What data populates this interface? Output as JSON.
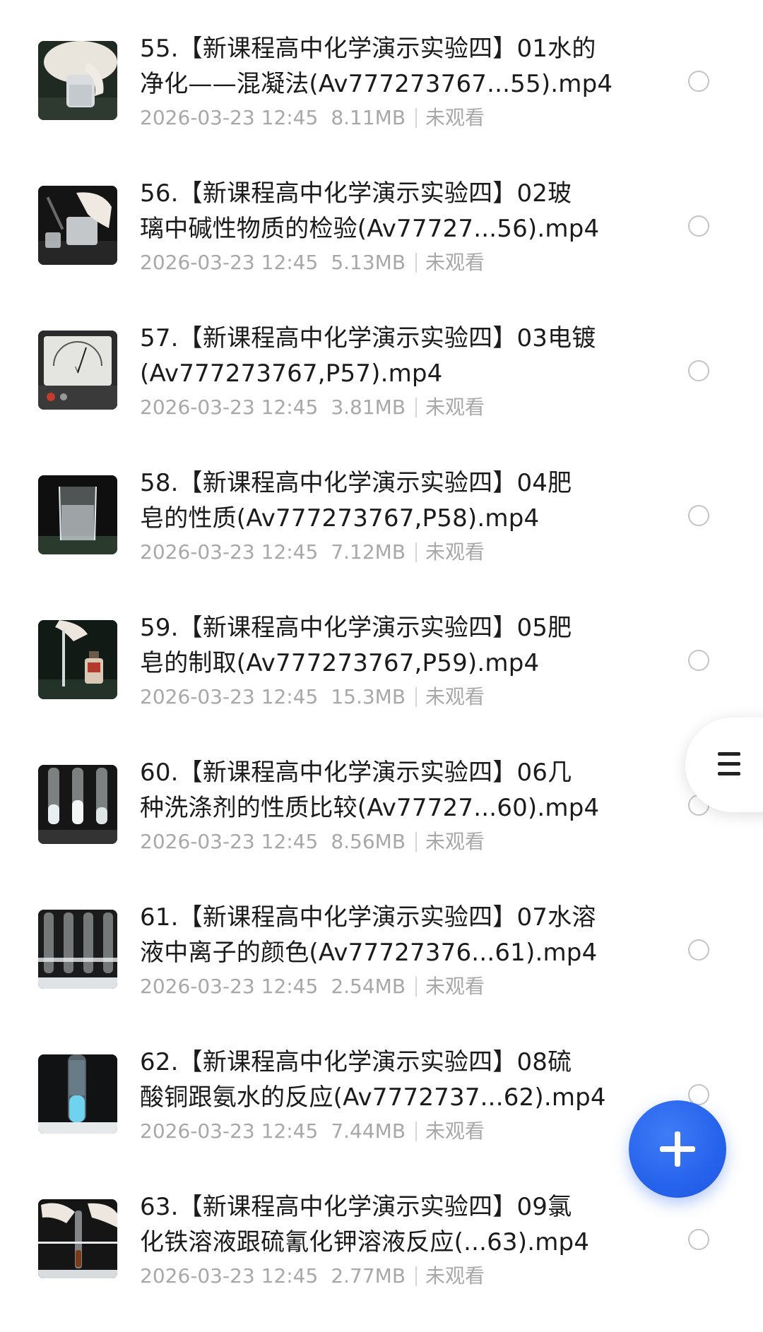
{
  "files": [
    {
      "title_line1": "55.【新课程高中化学演示实验四】01水的",
      "title_line2": "净化——混凝法(Av777273767...55).mp4",
      "date": "2026-03-23 12:45",
      "size": "8.11MB",
      "status": "未观看",
      "thumb_icon": "hand-holding-bottle-thumbnail"
    },
    {
      "title_line1": "56.【新课程高中化学演示实验四】02玻",
      "title_line2": "璃中碱性物质的检验(Av77727...56).mp4",
      "date": "2026-03-23 12:45",
      "size": "5.13MB",
      "status": "未观看",
      "thumb_icon": "hand-with-glass-thumbnail"
    },
    {
      "title_line1": "57.【新课程高中化学演示实验四】03电镀",
      "title_line2": "(Av777273767,P57).mp4",
      "date": "2026-03-23 12:45",
      "size": "3.81MB",
      "status": "未观看",
      "thumb_icon": "voltmeter-thumbnail"
    },
    {
      "title_line1": "58.【新课程高中化学演示实验四】04肥",
      "title_line2": "皂的性质(Av777273767,P58).mp4",
      "date": "2026-03-23 12:45",
      "size": "7.12MB",
      "status": "未观看",
      "thumb_icon": "beaker-thumbnail"
    },
    {
      "title_line1": "59.【新课程高中化学演示实验四】05肥",
      "title_line2": "皂的制取(Av777273767,P59).mp4",
      "date": "2026-03-23 12:45",
      "size": "15.3MB",
      "status": "未观看",
      "thumb_icon": "bottle-and-rod-thumbnail"
    },
    {
      "title_line1": "60.【新课程高中化学演示实验四】06几",
      "title_line2": "种洗涤剂的性质比较(Av77727...60).mp4",
      "date": "2026-03-23 12:45",
      "size": "8.56MB",
      "status": "未观看",
      "thumb_icon": "test-tubes-thumbnail"
    },
    {
      "title_line1": "61.【新课程高中化学演示实验四】07水溶",
      "title_line2": "液中离子的颜色(Av77727376...61).mp4",
      "date": "2026-03-23 12:45",
      "size": "2.54MB",
      "status": "未观看",
      "thumb_icon": "test-tube-rack-thumbnail"
    },
    {
      "title_line1": "62.【新课程高中化学演示实验四】08硫",
      "title_line2": "酸铜跟氨水的反应(Av7772737...62).mp4",
      "date": "2026-03-23 12:45",
      "size": "7.44MB",
      "status": "未观看",
      "thumb_icon": "blue-solution-tube-thumbnail"
    },
    {
      "title_line1": "63.【新课程高中化学演示实验四】09氯",
      "title_line2": "化铁溶液跟硫氰化钾溶液反应(...63).mp4",
      "date": "2026-03-23 12:45",
      "size": "2.77MB",
      "status": "未观看",
      "thumb_icon": "hand-with-tube-thumbnail"
    }
  ],
  "side_tab": {
    "icon": "menu-icon"
  },
  "fab": {
    "icon": "plus-icon"
  },
  "colors": {
    "title": "#1b1b1b",
    "meta": "#a8a8a8",
    "fab": "#2663ec",
    "radio_border": "#c4c4c4"
  }
}
